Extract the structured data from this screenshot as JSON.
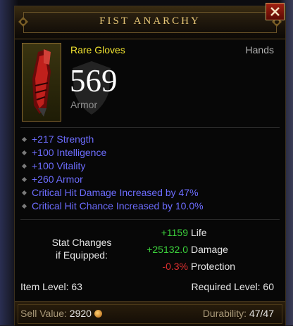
{
  "item": {
    "name": "FIST ANARCHY",
    "rarity_type": "Rare Gloves",
    "slot": "Hands",
    "armor_value": "569",
    "armor_label": "Armor"
  },
  "affixes": [
    "+217 Strength",
    "+100 Intelligence",
    "+100 Vitality",
    "+260 Armor",
    "Critical Hit Damage Increased by 47%",
    "Critical Hit Chance Increased by 10.0%"
  ],
  "stat_changes": {
    "title_line1": "Stat Changes",
    "title_line2": "if Equipped:",
    "rows": [
      {
        "value": "+1159",
        "label": "Life",
        "color": "#3cd23c"
      },
      {
        "value": "+25132.0",
        "label": "Damage",
        "color": "#3cd23c"
      },
      {
        "value": "-0.3%",
        "label": "Protection",
        "color": "#e03030"
      }
    ]
  },
  "levels": {
    "item_level": "Item Level: 63",
    "required_level": "Required Level: 60"
  },
  "footer": {
    "sell_label": "Sell Value:",
    "sell_value": "2920",
    "durability_label": "Durability:",
    "durability_value": "47/47"
  },
  "colors": {
    "rarity": "#f2e430",
    "affix": "#6d6dff",
    "title": "#e8c878",
    "positive": "#3cd23c",
    "negative": "#e03030"
  },
  "icons": {
    "close": "close-icon",
    "gold": "gold-coin-icon",
    "item": "glove-icon"
  }
}
